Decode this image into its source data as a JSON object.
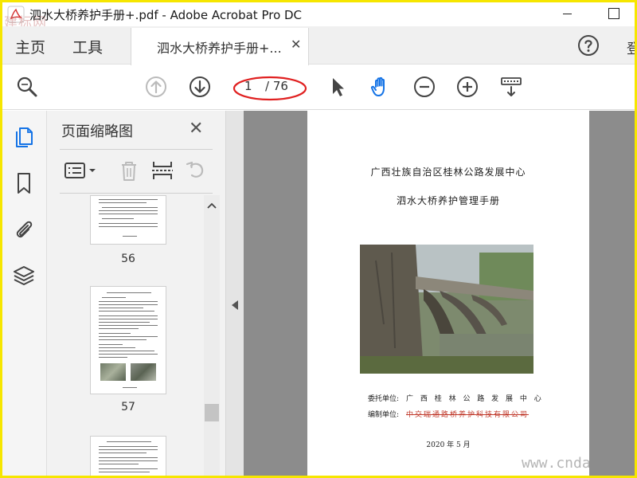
{
  "window": {
    "title": "泗水大桥养护手册+.pdf - Adobe Acrobat Pro DC",
    "watermark_top": "建标网"
  },
  "tabs": {
    "home_label": "主页",
    "tools_label": "工具",
    "document_tab_label": "泗水大桥养护手册+...",
    "close_glyph": "✕",
    "signin_partial": "登"
  },
  "toolbar": {
    "page_current": "1",
    "page_total": "/ 76",
    "annotation_color": "#e02020",
    "hand_tool_color": "#1473e6"
  },
  "thumbnail_panel": {
    "title": "页面缩略图",
    "close_glyph": "✕",
    "thumbnails": [
      {
        "page_number": "56"
      },
      {
        "page_number": "57"
      },
      {
        "page_number": ""
      }
    ]
  },
  "document_page": {
    "organization": "广西壮族自治区桂林公路发展中心",
    "title": "泗水大桥养护管理手册",
    "commissioned_label": "委托单位:",
    "commissioned_value": "广 西 桂 林 公 路 发 展 中 心",
    "prepared_label": "编制单位:",
    "prepared_value": "中交瑞通路桥养护科技有限公司",
    "date": "2020 年 5 月"
  },
  "watermark_bottom": "www.cnda"
}
